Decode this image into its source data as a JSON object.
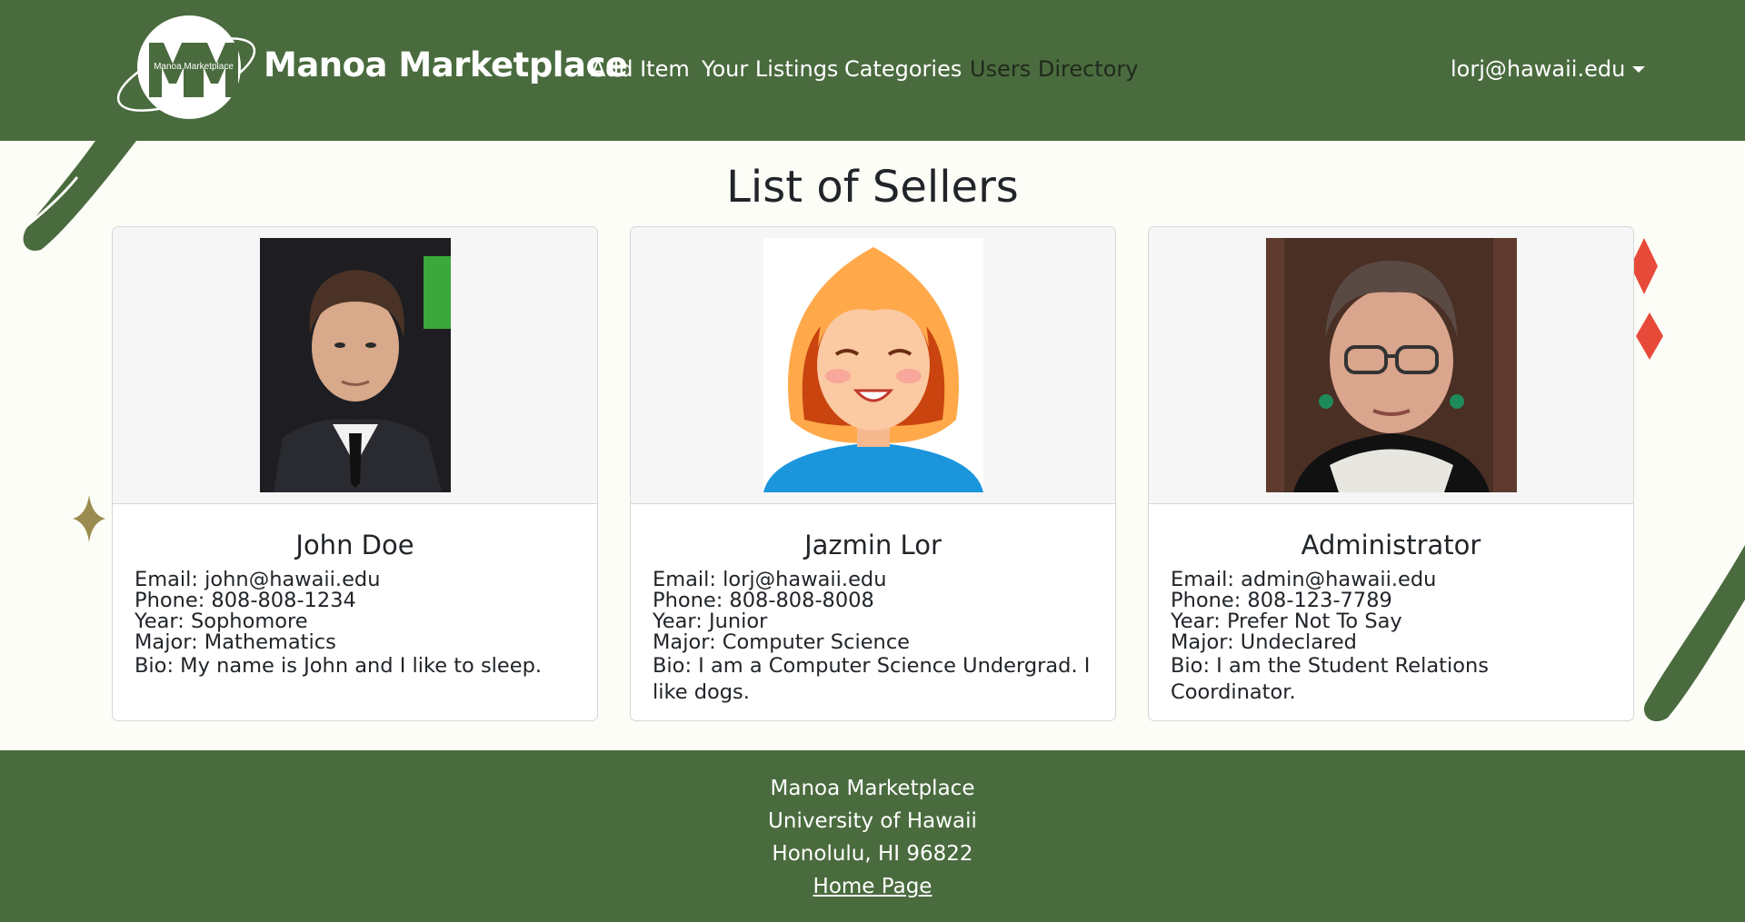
{
  "navbar": {
    "logo_text": "Manoa Marketplace",
    "brand": "Manoa Marketplace",
    "links": [
      "Add Item",
      "Your Listings",
      "Categories",
      "Users Directory"
    ],
    "user": "lorj@hawaii.edu"
  },
  "page_title": "List of Sellers",
  "sellers": [
    {
      "name": "John Doe",
      "email": "Email: john@hawaii.edu",
      "phone": "Phone: 808-808-1234",
      "year": "Year: Sophomore",
      "major": "Major: Mathematics",
      "bio": "Bio: My name is John and I like to sleep."
    },
    {
      "name": "Jazmin Lor",
      "email": "Email: lorj@hawaii.edu",
      "phone": "Phone: 808-808-8008",
      "year": "Year: Junior",
      "major": "Major: Computer Science",
      "bio": "Bio: I am a Computer Science Undergrad. I like dogs."
    },
    {
      "name": "Administrator",
      "email": "Email: admin@hawaii.edu",
      "phone": "Phone: 808-123-7789",
      "year": "Year: Prefer Not To Say",
      "major": "Major: Undeclared",
      "bio": "Bio: I am the Student Relations Coordinator."
    }
  ],
  "footer": {
    "line1": "Manoa Marketplace",
    "line2": "University of Hawaii",
    "line3": "Honolulu, HI 96822",
    "link": "Home Page"
  },
  "colors": {
    "navbar_bg": "#4a6b3e",
    "page_bg": "#fdfdf8",
    "accent_red": "#e84a3a",
    "accent_gold": "#9a8c4e"
  }
}
